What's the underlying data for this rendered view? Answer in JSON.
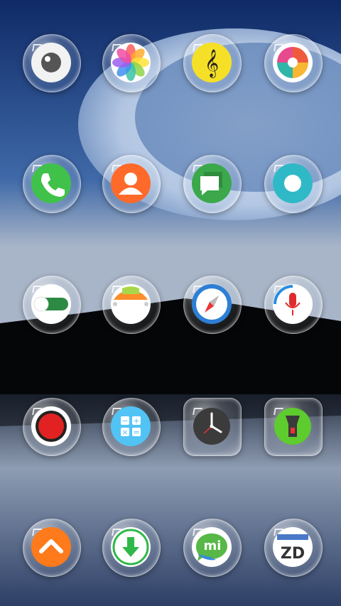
{
  "screen": {
    "wallpaper": "night-sky-planet-over-lake",
    "accent_colors": {
      "sky_top": "#0f2a66",
      "sky_mid": "#3f69a8",
      "horizon": "#a8b5c8",
      "land": "#050608",
      "water": "#5f7a9e"
    }
  },
  "home": {
    "rows": [
      [
        {
          "icon": "eye-icon",
          "color": "#f2f2f2"
        },
        {
          "icon": "photos-icon",
          "color": "#ffffff"
        },
        {
          "icon": "music-icon",
          "color": "#f6e027"
        },
        {
          "icon": "pinwheel-icon",
          "color": "#ffffff"
        }
      ],
      [
        {
          "icon": "phone-icon",
          "color": "#3fc14a"
        },
        {
          "icon": "contacts-icon",
          "color": "#ff6a2a"
        },
        {
          "icon": "messages-icon",
          "color": "#3aa84b"
        },
        {
          "icon": "ring-app-icon",
          "color": "#2fb9c7"
        }
      ],
      [
        {
          "icon": "toggle-settings-icon",
          "color": "#2c8a43"
        },
        {
          "icon": "calendar-icon",
          "color": "#ffffff"
        },
        {
          "icon": "compass-icon",
          "color": "#2d7fd6"
        },
        {
          "icon": "microphone-icon",
          "color": "#e02b2b"
        }
      ],
      [
        {
          "icon": "record-icon",
          "color": "#e22222"
        },
        {
          "icon": "calculator-icon",
          "color": "#52c3f5"
        },
        {
          "icon": "clock-icon",
          "color": "#3b3b3b"
        },
        {
          "icon": "flashlight-icon",
          "color": "#5ecb2e"
        }
      ],
      [
        {
          "icon": "arrow-up-icon",
          "color": "#ff7a1a"
        },
        {
          "icon": "download-icon",
          "color": "#2fb84a"
        },
        {
          "icon": "mi-chat-icon",
          "color": "#57b848"
        },
        {
          "icon": "zd-app-icon",
          "color": "#4a78c8"
        }
      ]
    ],
    "visible_text": {
      "mi_chat_glyph": "mi",
      "zd_glyph": "ZD",
      "music_glyph": "𝄞"
    }
  }
}
